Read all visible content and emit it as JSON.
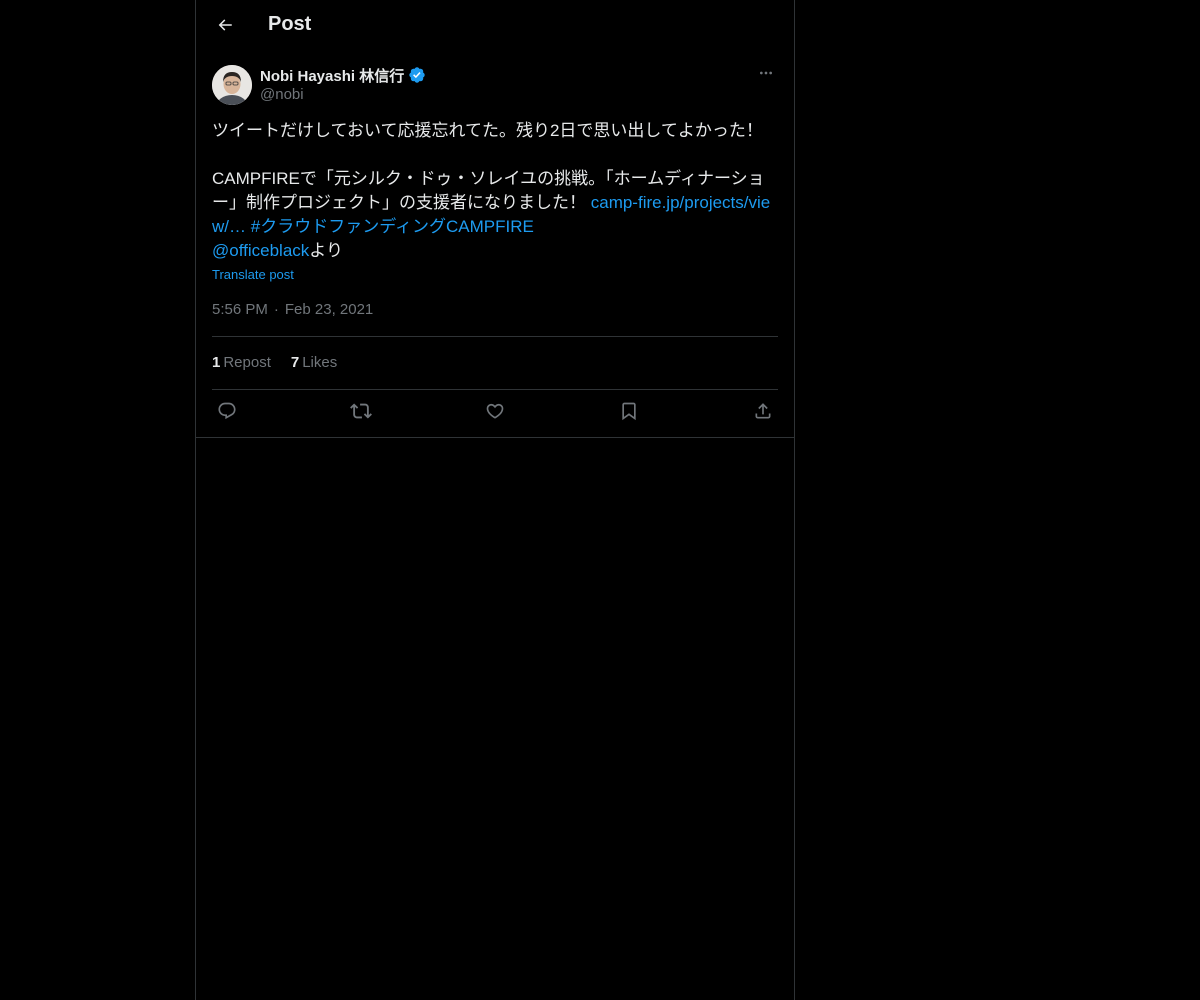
{
  "header": {
    "title": "Post",
    "back_icon": "arrow-left-icon"
  },
  "post": {
    "author": {
      "display_name": "Nobi Hayashi 林信行",
      "handle": "@nobi",
      "verified_icon": "verified-badge-icon"
    },
    "more_icon": "more-dots-icon",
    "text": {
      "line1": "ツイートだけしておいて応援忘れてた。残り2日で思い出してよかった！",
      "line2_text": "CAMPFIREで「元シルク・ドゥ・ソレイユの挑戦。「ホームディナーショー」制作プロジェクト」の支援者になりました！ ",
      "link_url_text": "camp-fire.jp/projects/view/…",
      "hashtag": "#クラウドファンディングCAMPFIRE",
      "mention": "@officeblack",
      "suffix": "より"
    },
    "translate_label": "Translate post",
    "time": "5:56 PM",
    "date": "Feb 23, 2021",
    "stats": {
      "reposts_count": "1",
      "reposts_label": "Repost",
      "likes_count": "7",
      "likes_label": "Likes"
    },
    "actions": [
      "reply-icon",
      "repost-icon",
      "like-icon",
      "bookmark-icon",
      "share-icon"
    ]
  },
  "colors": {
    "background": "#000000",
    "text": "#e7e9ea",
    "muted": "#71767b",
    "link": "#1d9bf0",
    "border": "#2f3336"
  }
}
